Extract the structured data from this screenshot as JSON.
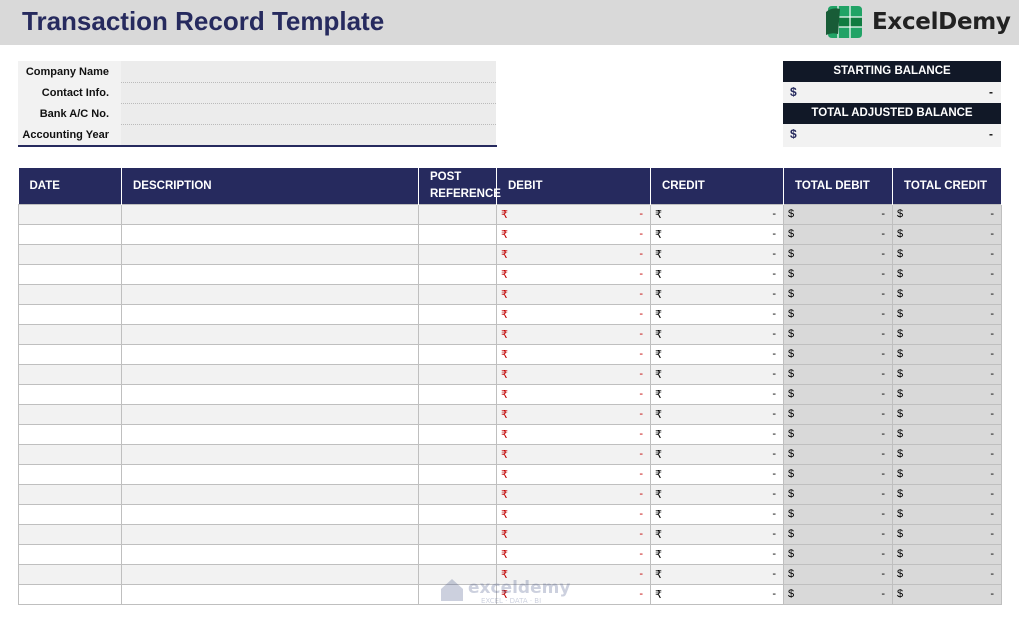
{
  "header": {
    "title": "Transaction Record Template",
    "logo_text": "ExcelDemy"
  },
  "info": {
    "rows": [
      {
        "label": "Company Name",
        "value": ""
      },
      {
        "label": "Contact Info.",
        "value": ""
      },
      {
        "label": "Bank A/C No.",
        "value": ""
      },
      {
        "label": "Accounting Year",
        "value": ""
      }
    ]
  },
  "balances": {
    "starting_label": "STARTING BALANCE",
    "starting_currency": "$",
    "starting_value": "-",
    "adjusted_label": "TOTAL ADJUSTED BALANCE",
    "adjusted_currency": "$",
    "adjusted_value": "-"
  },
  "table": {
    "columns": [
      "DATE",
      "DESCRIPTION",
      "POST REFERENCE",
      "DEBIT",
      "CREDIT",
      "TOTAL DEBIT",
      "TOTAL CREDIT"
    ],
    "row_count": 20,
    "rupee": "₹",
    "dollar": "$",
    "empty": "-"
  },
  "watermark": {
    "text": "exceldemy",
    "sub": "EXCEL · DATA · BI"
  },
  "colors": {
    "navy": "#262a5e",
    "dark": "#111827",
    "red": "#c00000",
    "logo_green": "#21a366"
  }
}
